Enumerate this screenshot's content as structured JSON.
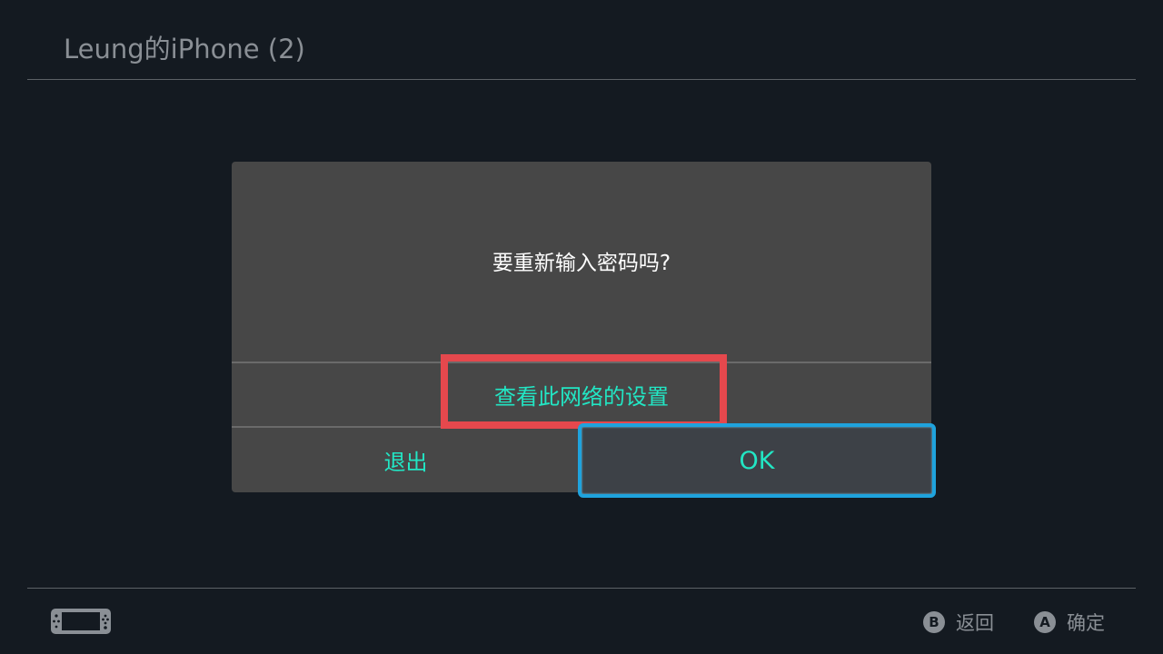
{
  "header": {
    "title": "Leung的iPhone (2)"
  },
  "dialog": {
    "message": "要重新输入密码吗?",
    "settings_link": "查看此网络的设置",
    "exit_label": "退出",
    "ok_label": "OK"
  },
  "footer": {
    "back": {
      "key": "B",
      "label": "返回"
    },
    "confirm": {
      "key": "A",
      "label": "确定"
    }
  },
  "colors": {
    "background": "#141a21",
    "dialog": "#474747",
    "accent_text": "#22e6c4",
    "focus_border": "#1fa3dd",
    "highlight": "#e5484d",
    "muted_text": "#8a8f95"
  },
  "icons": {
    "console": "handheld-console-icon"
  }
}
